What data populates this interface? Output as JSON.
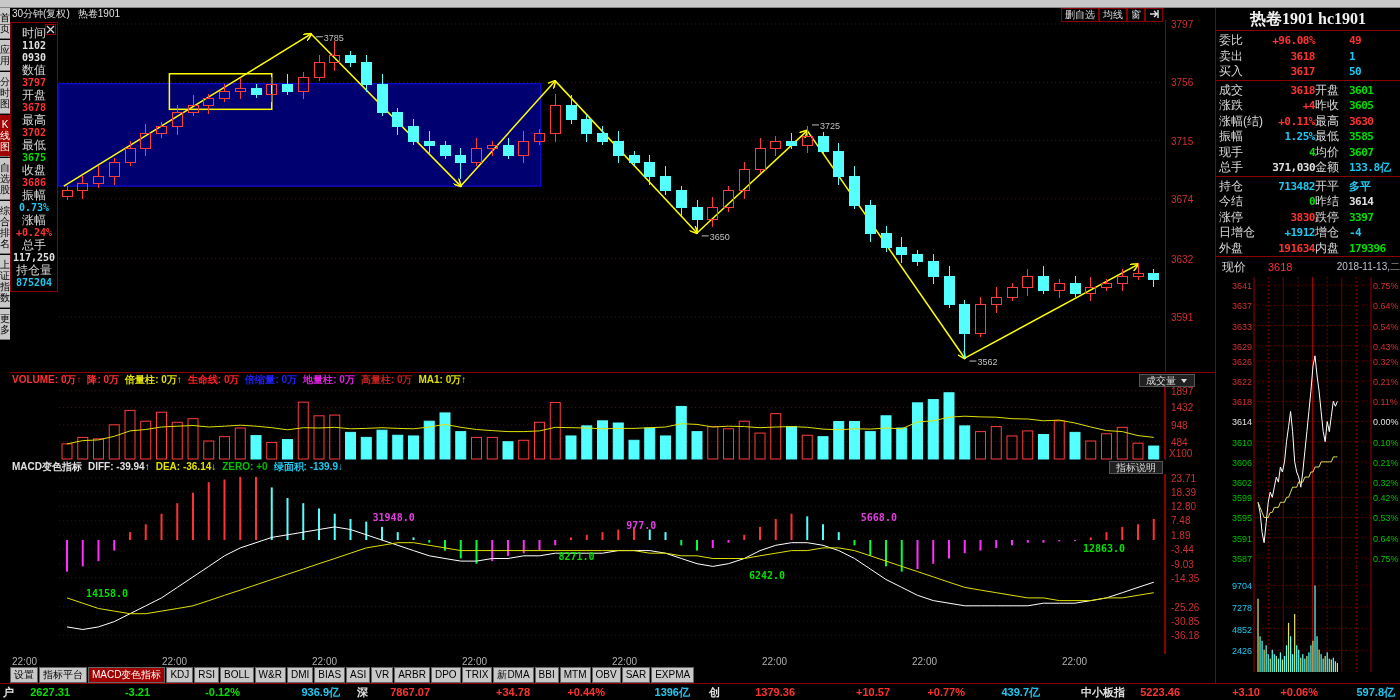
{
  "side_tabs": [
    {
      "label": "首页",
      "selected": false
    },
    {
      "label": "应用",
      "selected": false
    },
    {
      "label": "分时图",
      "selected": false
    },
    {
      "label": "K线图",
      "selected": true
    },
    {
      "label": "自选股",
      "selected": false
    },
    {
      "label": "综合排名",
      "selected": false
    },
    {
      "label": "上证指数",
      "selected": false
    },
    {
      "label": "更多",
      "selected": false
    }
  ],
  "chart_header": {
    "period": "30分钟(复权)",
    "symbol": "热卷1901"
  },
  "toolbar_buttons": [
    "删自选",
    "均线",
    "窗"
  ],
  "info_panel": [
    {
      "label": "时间",
      "values": [
        "1102",
        "0930"
      ],
      "color": "#e0e0e0"
    },
    {
      "label": "数值",
      "values": [
        "3797"
      ],
      "color": "#ff3232"
    },
    {
      "label": "开盘",
      "values": [
        "3678"
      ],
      "color": "#ff3232"
    },
    {
      "label": "最高",
      "values": [
        "3702"
      ],
      "color": "#ff3232"
    },
    {
      "label": "最低",
      "values": [
        "3675"
      ],
      "color": "#00e000"
    },
    {
      "label": "收盘",
      "values": [
        "3686"
      ],
      "color": "#ff3232"
    },
    {
      "label": "振幅",
      "values": [
        "0.73%"
      ],
      "color": "#1ec8f0"
    },
    {
      "label": "涨幅",
      "values": [
        "+0.24%"
      ],
      "color": "#ff3232"
    },
    {
      "label": "总手",
      "values": [
        "117,250"
      ],
      "color": "#e0e0e0"
    },
    {
      "label": "持仓量",
      "values": [
        "875204"
      ],
      "color": "#1ec8f0"
    }
  ],
  "price_chart": {
    "extreme_labels": [
      "3785",
      "3650",
      "3725",
      "3562"
    ],
    "chart_data": {
      "type": "candlestick",
      "ylim": [
        3552.3,
        3799.8
      ],
      "grid": true,
      "yticks": [
        3797,
        3756,
        3715,
        3674,
        3632,
        3591
      ],
      "ohlc": [
        [
          3676,
          3683,
          3673,
          3680
        ],
        [
          3680,
          3690,
          3674,
          3685
        ],
        [
          3685,
          3697,
          3682,
          3690
        ],
        [
          3690,
          3703,
          3684,
          3700
        ],
        [
          3700,
          3715,
          3697,
          3710
        ],
        [
          3710,
          3727,
          3704,
          3720
        ],
        [
          3720,
          3728,
          3717,
          3725
        ],
        [
          3725,
          3740,
          3719,
          3735
        ],
        [
          3735,
          3747,
          3732,
          3740
        ],
        [
          3740,
          3748,
          3734,
          3745
        ],
        [
          3745,
          3755,
          3742,
          3750
        ],
        [
          3750,
          3759,
          3744,
          3752
        ],
        [
          3752,
          3755,
          3745,
          3748
        ],
        [
          3748,
          3760,
          3742,
          3755
        ],
        [
          3755,
          3762,
          3747,
          3750
        ],
        [
          3750,
          3763,
          3744,
          3760
        ],
        [
          3760,
          3775,
          3757,
          3770
        ],
        [
          3770,
          3785,
          3764,
          3775
        ],
        [
          3775,
          3778,
          3767,
          3770
        ],
        [
          3770,
          3775,
          3749,
          3755
        ],
        [
          3755,
          3762,
          3732,
          3735
        ],
        [
          3735,
          3738,
          3719,
          3725
        ],
        [
          3725,
          3730,
          3712,
          3715
        ],
        [
          3715,
          3722,
          3706,
          3712
        ],
        [
          3712,
          3715,
          3702,
          3705
        ],
        [
          3705,
          3710,
          3688,
          3700
        ],
        [
          3700,
          3717,
          3697,
          3710
        ],
        [
          3710,
          3715,
          3704,
          3712
        ],
        [
          3712,
          3717,
          3702,
          3705
        ],
        [
          3705,
          3722,
          3699,
          3715
        ],
        [
          3715,
          3723,
          3712,
          3720
        ],
        [
          3720,
          3748,
          3714,
          3740
        ],
        [
          3740,
          3747,
          3727,
          3730
        ],
        [
          3730,
          3733,
          3714,
          3720
        ],
        [
          3720,
          3725,
          3712,
          3715
        ],
        [
          3715,
          3722,
          3699,
          3705
        ],
        [
          3705,
          3708,
          3697,
          3700
        ],
        [
          3700,
          3705,
          3684,
          3690
        ],
        [
          3690,
          3697,
          3677,
          3680
        ],
        [
          3680,
          3683,
          3662,
          3668
        ],
        [
          3668,
          3673,
          3650,
          3660
        ],
        [
          3660,
          3675,
          3654,
          3668
        ],
        [
          3668,
          3683,
          3665,
          3680
        ],
        [
          3680,
          3700,
          3674,
          3695
        ],
        [
          3695,
          3717,
          3692,
          3710
        ],
        [
          3710,
          3718,
          3704,
          3715
        ],
        [
          3715,
          3720,
          3709,
          3712
        ],
        [
          3712,
          3725,
          3706,
          3718
        ],
        [
          3718,
          3721,
          3705,
          3708
        ],
        [
          3708,
          3713,
          3684,
          3690
        ],
        [
          3690,
          3697,
          3667,
          3670
        ],
        [
          3670,
          3673,
          3644,
          3650
        ],
        [
          3650,
          3655,
          3637,
          3640
        ],
        [
          3640,
          3647,
          3629,
          3635
        ],
        [
          3635,
          3638,
          3627,
          3630
        ],
        [
          3630,
          3635,
          3614,
          3620
        ],
        [
          3620,
          3627,
          3597,
          3600
        ],
        [
          3600,
          3603,
          3562,
          3580
        ],
        [
          3580,
          3605,
          3577,
          3600
        ],
        [
          3600,
          3612,
          3594,
          3605
        ],
        [
          3605,
          3615,
          3602,
          3612
        ],
        [
          3612,
          3625,
          3606,
          3620
        ],
        [
          3620,
          3627,
          3607,
          3610
        ],
        [
          3610,
          3618,
          3604,
          3615
        ],
        [
          3615,
          3620,
          3605,
          3608
        ],
        [
          3608,
          3619,
          3602,
          3612
        ],
        [
          3612,
          3618,
          3609,
          3615
        ],
        [
          3615,
          3625,
          3609,
          3620
        ],
        [
          3620,
          3629,
          3617,
          3622
        ],
        [
          3622,
          3625,
          3612,
          3618
        ]
      ]
    }
  },
  "volume_panel": {
    "legend": [
      {
        "text": "VOLUME: 0万↑",
        "color": "#ff3232"
      },
      {
        "text": "降: 0万",
        "color": "#ff3232"
      },
      {
        "text": "倍量柱: 0万↑",
        "color": "#e0e000"
      },
      {
        "text": "生命线: 0万",
        "color": "#ff2020"
      },
      {
        "text": "倍缩量: 0万",
        "color": "#2020ff"
      },
      {
        "text": "地量柱: 0万",
        "color": "#e020e0"
      },
      {
        "text": "高量柱: 0万",
        "color": "#c02020"
      },
      {
        "text": "MA1: 0万↑",
        "color": "#e0e000"
      }
    ],
    "dropdown": "成交量",
    "chart_data": {
      "type": "bar",
      "ylabel": "X100",
      "ylim": [
        0,
        2000
      ],
      "grid": true,
      "yticks": [
        1897,
        1432,
        948,
        484
      ],
      "values": [
        420,
        600,
        560,
        950,
        1350,
        1050,
        1300,
        1020,
        1120,
        500,
        620,
        860,
        650,
        460,
        540,
        1580,
        1200,
        1220,
        740,
        600,
        800,
        660,
        640,
        1050,
        1280,
        760,
        600,
        600,
        480,
        520,
        1020,
        1570,
        640,
        920,
        1060,
        1000,
        520,
        860,
        640,
        1460,
        760,
        900,
        840,
        1050,
        720,
        1260,
        900,
        660,
        620,
        1040,
        1040,
        760,
        1200,
        860,
        1560,
        1650,
        1840,
        920,
        760,
        900,
        640,
        780,
        680,
        1060,
        740,
        500,
        700,
        880,
        440,
        360
      ]
    },
    "ma_line": {
      "chart_data": {
        "type": "line",
        "ylim": [
          0,
          2000
        ],
        "series": [
          {
            "color": "#e0e000",
            "values": [
              420,
              510,
              530,
              630,
              780,
              820,
              890,
              910,
              930,
              890,
              910,
              940,
              910,
              870,
              810,
              870,
              860,
              880,
              840,
              850,
              870,
              850,
              840,
              890,
              960,
              880,
              820,
              790,
              760,
              760,
              780,
              880,
              870,
              860,
              840,
              850,
              850,
              870,
              890,
              980,
              960,
              890,
              910,
              900,
              870,
              890,
              900,
              880,
              830,
              810,
              840,
              830,
              860,
              840,
              1030,
              1060,
              1160,
              1190,
              1170,
              1160,
              1120,
              1110,
              1060,
              1080,
              1000,
              890,
              790,
              760,
              650,
              600
            ]
          }
        ]
      }
    }
  },
  "macd_panel": {
    "legend": [
      {
        "text": "MACD变色指标",
        "color": "#e0e0e0"
      },
      {
        "text": "DIFF: -39.94↑",
        "color": "#e0e0e0"
      },
      {
        "text": "DEA: -36.14↓",
        "color": "#e0e000"
      },
      {
        "text": "ZERO: +0",
        "color": "#00c000"
      },
      {
        "text": "绿面积: -139.9↓",
        "color": "#1ec8f0"
      }
    ],
    "button": "指标说明",
    "chart_data": {
      "type": "bar",
      "ylim": [
        -43.3,
        25.1
      ],
      "grid": true,
      "yticks": [
        23.71,
        18.39,
        {
          "value": 12.8,
          "label": "12.80"
        },
        7.48,
        1.89,
        -3.44,
        -9.03,
        -14.35,
        -25.26,
        -30.85,
        -36.18
      ],
      "values": [
        -12,
        -10,
        -8,
        -4,
        3,
        6,
        10,
        14,
        18,
        22,
        23,
        24,
        24,
        20,
        16,
        14,
        12,
        10,
        8,
        7,
        5,
        3,
        1,
        -1,
        -4,
        -7,
        -9,
        -8,
        -6,
        -5,
        -4,
        -2,
        1,
        2,
        3,
        4,
        5,
        4,
        3,
        -2,
        -4,
        -3,
        -1,
        2,
        5,
        8,
        10,
        9,
        6,
        3,
        -2,
        -6,
        -10,
        -12,
        -11,
        -9,
        -7,
        -5,
        -4,
        -3,
        -2,
        -1,
        -1,
        -0.5,
        -0.3,
        1,
        3,
        5,
        6,
        8
      ]
    },
    "lines": {
      "chart_data": {
        "type": "line",
        "ylim": [
          -43.3,
          25.1
        ],
        "series": [
          {
            "color": "#ffffff",
            "values": [
              -33,
              -34,
              -33,
              -31,
              -28,
              -25,
              -22,
              -18,
              -14,
              -10,
              -6,
              -3,
              -1,
              1,
              2,
              3,
              4,
              5,
              4,
              2,
              0,
              -2,
              -4,
              -6,
              -7,
              -8,
              -8,
              -7,
              -7,
              -6,
              -6,
              -5,
              -5,
              -5,
              -5,
              -4,
              -4,
              -4,
              -5,
              -7,
              -9,
              -10,
              -9,
              -7,
              -4,
              -2,
              -1,
              -1,
              -2,
              -4,
              -7,
              -11,
              -15,
              -18,
              -21,
              -23,
              -24,
              -25,
              -25,
              -25,
              -25,
              -25,
              -24,
              -24,
              -24,
              -23,
              -22,
              -20,
              -18,
              -16
            ]
          },
          {
            "color": "#e0e000",
            "values": [
              -22,
              -24,
              -26,
              -27,
              -28,
              -28,
              -27,
              -26,
              -25,
              -23,
              -21,
              -19,
              -17,
              -15,
              -13,
              -11,
              -9,
              -7,
              -5,
              -3,
              -2,
              -1,
              -1,
              -2,
              -3,
              -4,
              -4,
              -4,
              -4,
              -4,
              -4,
              -4,
              -4,
              -4,
              -4,
              -4,
              -4,
              -5,
              -5,
              -6,
              -6,
              -7,
              -7,
              -7,
              -6,
              -5,
              -4,
              -4,
              -3,
              -3,
              -4,
              -6,
              -8,
              -10,
              -12,
              -14,
              -16,
              -18,
              -19,
              -20,
              -21,
              -22,
              -22,
              -23,
              -23,
              -23,
              -22,
              -22,
              -21,
              -20
            ]
          }
        ]
      }
    },
    "area_labels": [
      {
        "text": "31948.0",
        "color": "#e040e0"
      },
      {
        "text": "977.0",
        "color": "#e040e0"
      },
      {
        "text": "5668.0",
        "color": "#e040e0"
      },
      {
        "text": "14158.0",
        "color": "#00e000"
      },
      {
        "text": "8271.0",
        "color": "#00e000"
      },
      {
        "text": "6242.0",
        "color": "#00e000"
      },
      {
        "text": "12863.0",
        "color": "#00e000"
      }
    ]
  },
  "time_axis": [
    "22:00",
    "22:00",
    "22:00",
    "22:00",
    "22:00",
    "22:00",
    "22:00",
    "22:00"
  ],
  "indicator_tabs": [
    {
      "label": "设置",
      "selected": false
    },
    {
      "label": "指标平台",
      "selected": false
    },
    {
      "label": "MACD变色指标",
      "selected": true
    },
    {
      "label": "KDJ",
      "selected": false
    },
    {
      "label": "RSI",
      "selected": false
    },
    {
      "label": "BOLL",
      "selected": false
    },
    {
      "label": "W&R",
      "selected": false
    },
    {
      "label": "DMI",
      "selected": false
    },
    {
      "label": "BIAS",
      "selected": false
    },
    {
      "label": "ASI",
      "selected": false
    },
    {
      "label": "VR",
      "selected": false
    },
    {
      "label": "ARBR",
      "selected": false
    },
    {
      "label": "DPO",
      "selected": false
    },
    {
      "label": "TRIX",
      "selected": false
    },
    {
      "label": "新DMA",
      "selected": false
    },
    {
      "label": "BBI",
      "selected": false
    },
    {
      "label": "MTM",
      "selected": false
    },
    {
      "label": "OBV",
      "selected": false
    },
    {
      "label": "SAR",
      "selected": false
    },
    {
      "label": "EXPMA",
      "selected": false
    }
  ],
  "quote_panel": {
    "title": "热卷1901 hc1901",
    "sections": [
      [
        {
          "label": "委比",
          "value": {
            "text": "+96.08%",
            "color": "#ff3232"
          },
          "value2": {
            "text": "49",
            "color": "#ff3232"
          }
        },
        {
          "label": "卖出",
          "value": {
            "text": "3618",
            "color": "#ff3232"
          },
          "value2": {
            "text": "1",
            "color": "#1ec8f0"
          }
        },
        {
          "label": "买入",
          "value": {
            "text": "3617",
            "color": "#ff3232"
          },
          "value2": {
            "text": "50",
            "color": "#1ec8f0"
          }
        }
      ],
      [
        {
          "label": "成交",
          "value": {
            "text": "3618",
            "color": "#ff3232"
          },
          "label2": "开盘",
          "value2": {
            "text": "3601",
            "color": "#00e000"
          }
        },
        {
          "label": "涨跌",
          "value": {
            "text": "+4",
            "color": "#ff3232"
          },
          "label2": "昨收",
          "value2": {
            "text": "3605",
            "color": "#00e000"
          }
        },
        {
          "label": "涨幅(结)",
          "value": {
            "text": "+0.11%",
            "color": "#ff3232"
          },
          "label2": "最高",
          "value2": {
            "text": "3630",
            "color": "#ff3232"
          }
        },
        {
          "label": "振幅",
          "value": {
            "text": "1.25%",
            "color": "#1ec8f0"
          },
          "label2": "最低",
          "value2": {
            "text": "3585",
            "color": "#00e000"
          }
        },
        {
          "label": "现手",
          "value": {
            "text": "4",
            "color": "#00e000"
          },
          "label2": "均价",
          "value2": {
            "text": "3607",
            "color": "#00e000"
          }
        },
        {
          "label": "总手",
          "value": {
            "text": "371,030",
            "color": "#e0e0e0"
          },
          "label2": "金额",
          "value2": {
            "text": "133.8亿",
            "color": "#1ec8f0"
          }
        }
      ],
      [
        {
          "label": "持仓",
          "value": {
            "text": "713482",
            "color": "#1ec8f0"
          },
          "label2": "开平",
          "value2": {
            "text": "多平",
            "color": "#1ec8f0"
          }
        },
        {
          "label": "今结",
          "value": {
            "text": "0",
            "color": "#00e000"
          },
          "label2": "昨结",
          "value2": {
            "text": "3614",
            "color": "#e0e0e0"
          }
        },
        {
          "label": "涨停",
          "value": {
            "text": "3830",
            "color": "#ff3232"
          },
          "label2": "跌停",
          "value2": {
            "text": "3397",
            "color": "#00e000"
          }
        },
        {
          "label": "日增仓",
          "value": {
            "text": "+1912",
            "color": "#1ec8f0"
          },
          "label2": "增仓",
          "value2": {
            "text": "-4",
            "color": "#1ec8f0"
          }
        },
        {
          "label": "外盘",
          "value": {
            "text": "191634",
            "color": "#ff3232"
          },
          "label2": "内盘",
          "value2": {
            "text": "179396",
            "color": "#00e000"
          }
        }
      ]
    ],
    "current": {
      "label": "现价",
      "value": "3618",
      "date": "2018-11-13,二"
    }
  },
  "intraday_chart": {
    "percent_labels": [
      "0.75%",
      "0.64%",
      "0.54%",
      "0.43%",
      "0.32%",
      "0.21%",
      "0.11%",
      "0.00%",
      "0.10%",
      "0.21%",
      "0.32%",
      "0.42%",
      "0.53%",
      "0.64%",
      "0.75%"
    ],
    "chart_data": {
      "type": "line",
      "ylim": [
        3585.2,
        3642.6
      ],
      "grid": true,
      "yticks": [
        3641,
        3637,
        3633,
        3629,
        3626,
        3622,
        3618,
        3614,
        3610,
        3606,
        3602,
        3599,
        3595,
        3591,
        3587
      ],
      "series": [
        {
          "color": "#ffffff",
          "values": [
            3598,
            3596,
            3592,
            3590,
            3594,
            3598,
            3600,
            3599,
            3601,
            3603,
            3602,
            3605,
            3604,
            3606,
            3610,
            3613,
            3616,
            3612,
            3606,
            3604,
            3603,
            3601,
            3604,
            3608,
            3612,
            3616,
            3620,
            3625,
            3627,
            3623,
            3620,
            3616,
            3612,
            3610,
            3614,
            3612,
            3615,
            3618,
            3617,
            3618,
            null,
            null,
            null,
            null,
            null,
            null,
            null,
            null,
            null,
            null,
            null,
            null,
            null,
            null,
            null,
            null
          ]
        },
        {
          "color": "#e0e060",
          "values": [
            3598,
            3597,
            3596,
            3595,
            3595,
            3595,
            3596,
            3596,
            3597,
            3597,
            3597,
            3598,
            3598,
            3598,
            3599,
            3599,
            3600,
            3601,
            3601,
            3601,
            3602,
            3602,
            3602,
            3603,
            3603,
            3603,
            3604,
            3604,
            3605,
            3605,
            3605,
            3606,
            3606,
            3606,
            3606,
            3606,
            3606,
            3607,
            3607,
            3607,
            null,
            null,
            null,
            null,
            null,
            null,
            null,
            null,
            null,
            null,
            null,
            null,
            null,
            null,
            null,
            null
          ]
        }
      ]
    }
  },
  "intraday_volume": {
    "chart_data": {
      "type": "bar",
      "ylim": [
        0,
        11760
      ],
      "grid": true,
      "yticks": [
        9704,
        7278,
        4852,
        2426
      ],
      "values": [
        8200,
        4000,
        3500,
        2500,
        3000,
        2000,
        1500,
        2500,
        2000,
        1800,
        1500,
        2200,
        1400,
        1800,
        3000,
        5500,
        4000,
        2000,
        6500,
        3000,
        2500,
        1600,
        2000,
        1500,
        1800,
        2200,
        3000,
        3500,
        9700,
        4000,
        2500,
        2000,
        1500,
        1800,
        2200,
        1500,
        1400,
        1600,
        1200,
        1000,
        null,
        null,
        null,
        null,
        null,
        null,
        null,
        null,
        null,
        null,
        null,
        null,
        null,
        null,
        null,
        null
      ]
    }
  },
  "status_bar": [
    {
      "text": "户",
      "color": "#e0e0e0"
    },
    {
      "text": "2627.31",
      "color": "#00e000"
    },
    {
      "text": "-3.21",
      "color": "#00e000"
    },
    {
      "text": "-0.12%",
      "color": "#00e000"
    },
    {
      "text": "936.9亿",
      "color": "#1ec8f0"
    },
    {
      "text": "深",
      "color": "#e0e0e0"
    },
    {
      "text": "7867.07",
      "color": "#ff3232"
    },
    {
      "text": "+34.78",
      "color": "#ff3232"
    },
    {
      "text": "+0.44%",
      "color": "#ff3232"
    },
    {
      "text": "1396亿",
      "color": "#1ec8f0"
    },
    {
      "text": "创",
      "color": "#e0e0e0"
    },
    {
      "text": "1379.36",
      "color": "#ff3232"
    },
    {
      "text": "+10.57",
      "color": "#ff3232"
    },
    {
      "text": "+0.77%",
      "color": "#ff3232"
    },
    {
      "text": "439.7亿",
      "color": "#1ec8f0"
    },
    {
      "text": "中小板指",
      "color": "#e0e0e0"
    },
    {
      "text": "5223.46",
      "color": "#ff3232"
    },
    {
      "text": "+3.10",
      "color": "#ff3232"
    },
    {
      "text": "+0.06%",
      "color": "#ff3232"
    },
    {
      "text": "597.8亿",
      "color": "#1ec8f0"
    }
  ]
}
